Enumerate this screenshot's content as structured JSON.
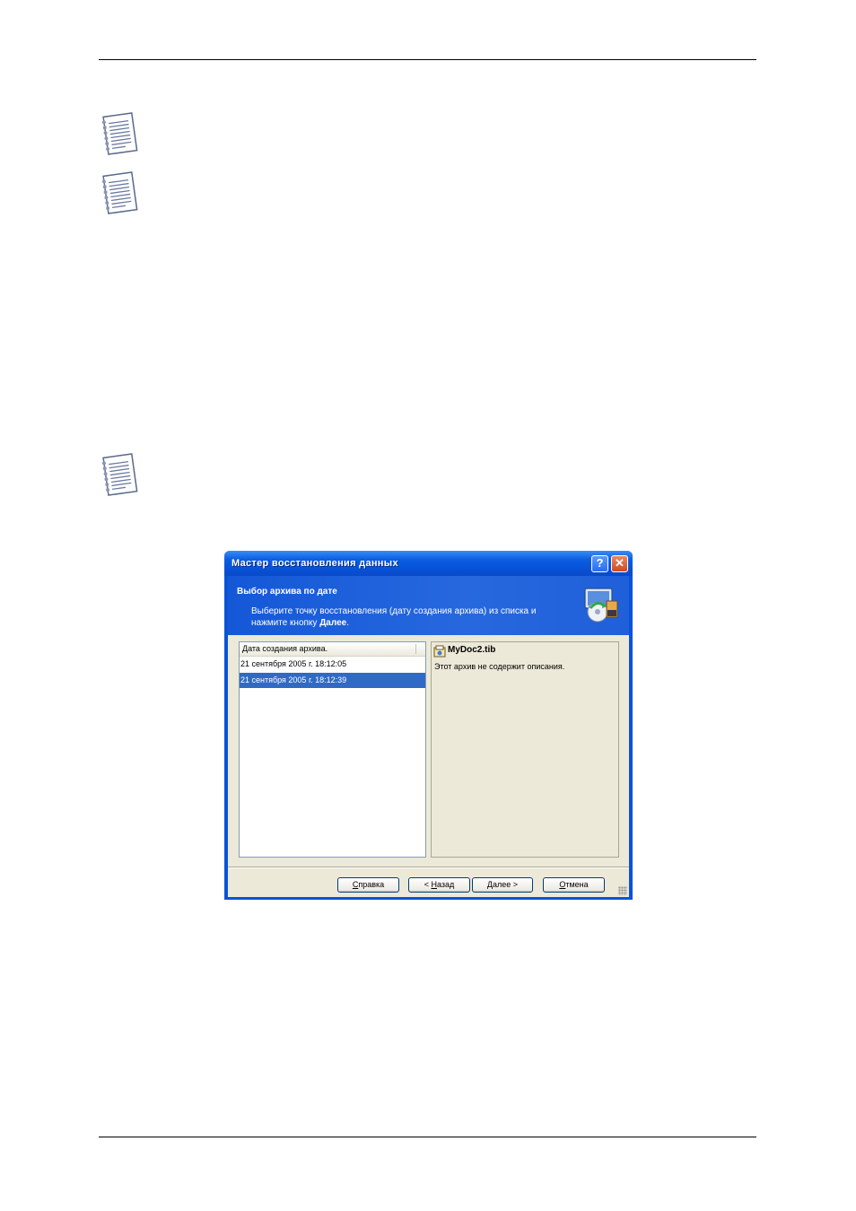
{
  "dialog": {
    "title": "Мастер восстановления данных",
    "help_glyph": "?",
    "close_glyph": "✕",
    "header_title": "Выбор архива по дате",
    "header_line1": "Выберите точку восстановления (дату создания архива) из списка и",
    "header_line2_prefix": "нажмите кнопку ",
    "header_line2_bold": "Далее",
    "header_line2_suffix": ".",
    "list": {
      "column_header": "Дата создания архива.",
      "rows": [
        {
          "label": "21 сентября 2005 г. 18:12:05",
          "selected": false
        },
        {
          "label": "21 сентября 2005 г. 18:12:39",
          "selected": true
        }
      ]
    },
    "details": {
      "archive_name": "MyDoc2.tib",
      "archive_description": "Этот архив не содержит описания."
    },
    "buttons": {
      "help_hotkey": "С",
      "help_rest": "правка",
      "back_prefix": "< ",
      "back_hotkey": "Н",
      "back_rest": "азад",
      "next_hotkey": "Д",
      "next_rest": "алее >",
      "cancel_hotkey": "О",
      "cancel_rest": "тмена"
    },
    "accent_color": "#0a53d6",
    "selection_color": "#316ac5"
  },
  "icons": {
    "note": "notepad-icon",
    "wizard": "restore-wizard-icon",
    "archive": "archive-file-icon"
  }
}
